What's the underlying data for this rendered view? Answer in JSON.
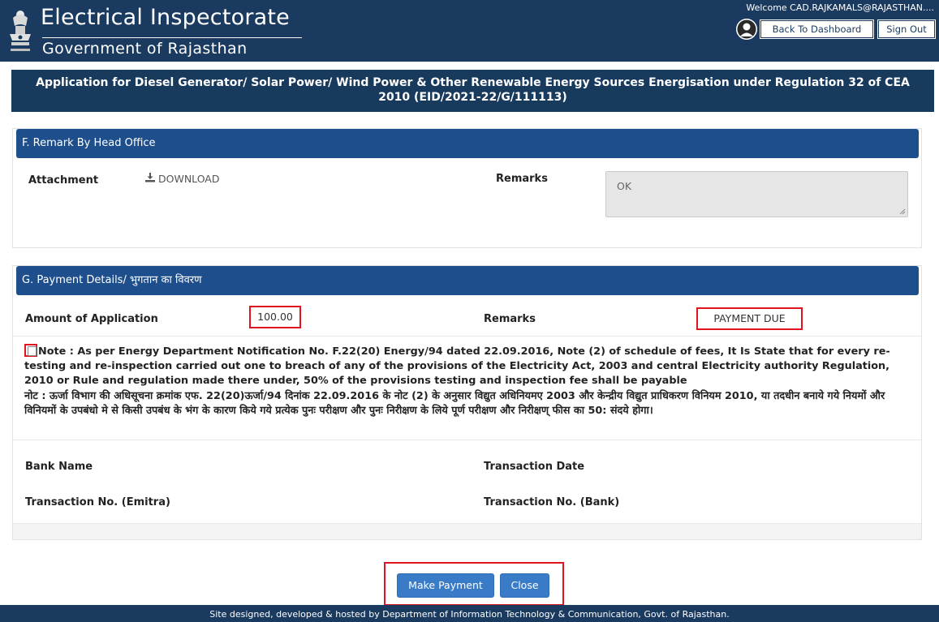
{
  "header": {
    "title": "Electrical Inspectorate",
    "subtitle": "Government of Rajasthan",
    "welcome": "Welcome CAD.RAJKAMALS@RAJASTHAN....",
    "back_button": "Back To Dashboard",
    "signout_button": "Sign Out",
    "icons": [
      "state-emblem-icon",
      "user-avatar-icon"
    ]
  },
  "page": {
    "title": "Application for Diesel Generator/ Solar Power/ Wind Power & Other Renewable Energy Sources Energisation under Regulation 32 of CEA 2010 (EID/2021-22/G/111113)"
  },
  "section_f": {
    "heading": "F. Remark By Head Office",
    "attachment_label": "Attachment",
    "download_label": "DOWNLOAD",
    "remarks_label": "Remarks",
    "remarks_value": "OK"
  },
  "section_g": {
    "heading": "G. Payment Details/ भुगतान का विवरण",
    "amount_label": "Amount of Application",
    "amount_value": "100.00",
    "remarks_label": "Remarks",
    "remarks_value": "PAYMENT DUE",
    "note_en": "Note : As per Energy Department Notification No. F.22(20) Energy/94 dated 22.09.2016, Note (2) of schedule of fees, It Is State that for every re-testing and re-inspection carried out one to breach of any of the provisions of the Electricity Act, 2003 and central Electricity authority Regulation, 2010 or Rule and regulation made there under, 50% of the provisions testing and inspection fee shall be payable",
    "note_hi": "नोट : ऊर्जा विभाग की अधिसूचना क्रमांक एफ. 22(20)ऊर्जा/94 दिनांक 22.09.2016 के नोट (2) के अनुसार विद्युत अधिनियमए 2003 और केन्द्रीय विद्युत प्राधिकरण विनियम 2010, या तदधीन बनाये गये नियमों और विनियमों के उपबंधो मे से किसी उपबंध के भंग के कारण किये गये प्रत्येक पुनः परीक्षण और पुनः निरीक्षण के लिये पूर्ण परीक्षण और निरीक्षण् फीस का 50: संदये होगा।",
    "bank_name_label": "Bank Name",
    "txn_date_label": "Transaction Date",
    "txn_emitra_label": "Transaction No. (Emitra)",
    "txn_bank_label": "Transaction No. (Bank)"
  },
  "actions": {
    "make_payment": "Make Payment",
    "close": "Close"
  },
  "footer": {
    "text": "Site designed, developed & hosted by Department of Information Technology & Communication, Govt. of Rajasthan."
  },
  "colors": {
    "header_bg": "#1a3a5f",
    "section_header_bg": "#1e4f8c",
    "button_bg": "#3a7bc8",
    "highlight_border": "#e0141e"
  }
}
